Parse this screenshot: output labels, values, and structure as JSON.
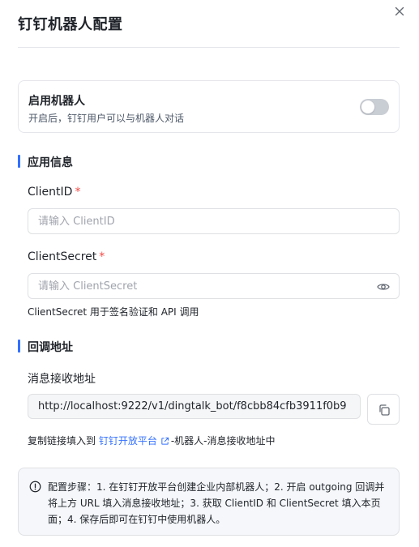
{
  "dialog": {
    "title": "钉钉机器人配置",
    "close_icon": "close-icon"
  },
  "robot_toggle": {
    "title": "启用机器人",
    "description": "开启后，钉钉用户可以与机器人对话",
    "enabled": false
  },
  "app_info": {
    "section_title": "应用信息",
    "client_id": {
      "label": "ClientID",
      "required_mark": "*",
      "value": "",
      "placeholder": "请输入 ClientID"
    },
    "client_secret": {
      "label": "ClientSecret",
      "required_mark": "*",
      "value": "",
      "placeholder": "请输入 ClientSecret",
      "toggle_icon": "eye-icon",
      "helper": "ClientSecret 用于签名验证和 API 调用"
    }
  },
  "callback": {
    "section_title": "回调地址",
    "url_label": "消息接收地址",
    "url_value": "http://localhost:9222/v1/dingtalk_bot/f8cbb84cfb3911f0b9",
    "copy_icon": "copy-icon",
    "hint_prefix": "复制链接填入到 ",
    "hint_link": "钉钉开放平台",
    "hint_suffix": "-机器人-消息接收地址中"
  },
  "info": {
    "icon": "info-icon",
    "text": "配置步骤：1. 在钉钉开放平台创建企业内部机器人；2. 开启 outgoing 回调并将上方 URL 填入消息接收地址；3. 获取 ClientID 和 ClientSecret 填入本页面；4. 保存后即可在钉钉中使用机器人。"
  },
  "colors": {
    "accent": "#3370ff",
    "required": "#f54a45",
    "switch_off": "#c9cdd4"
  }
}
